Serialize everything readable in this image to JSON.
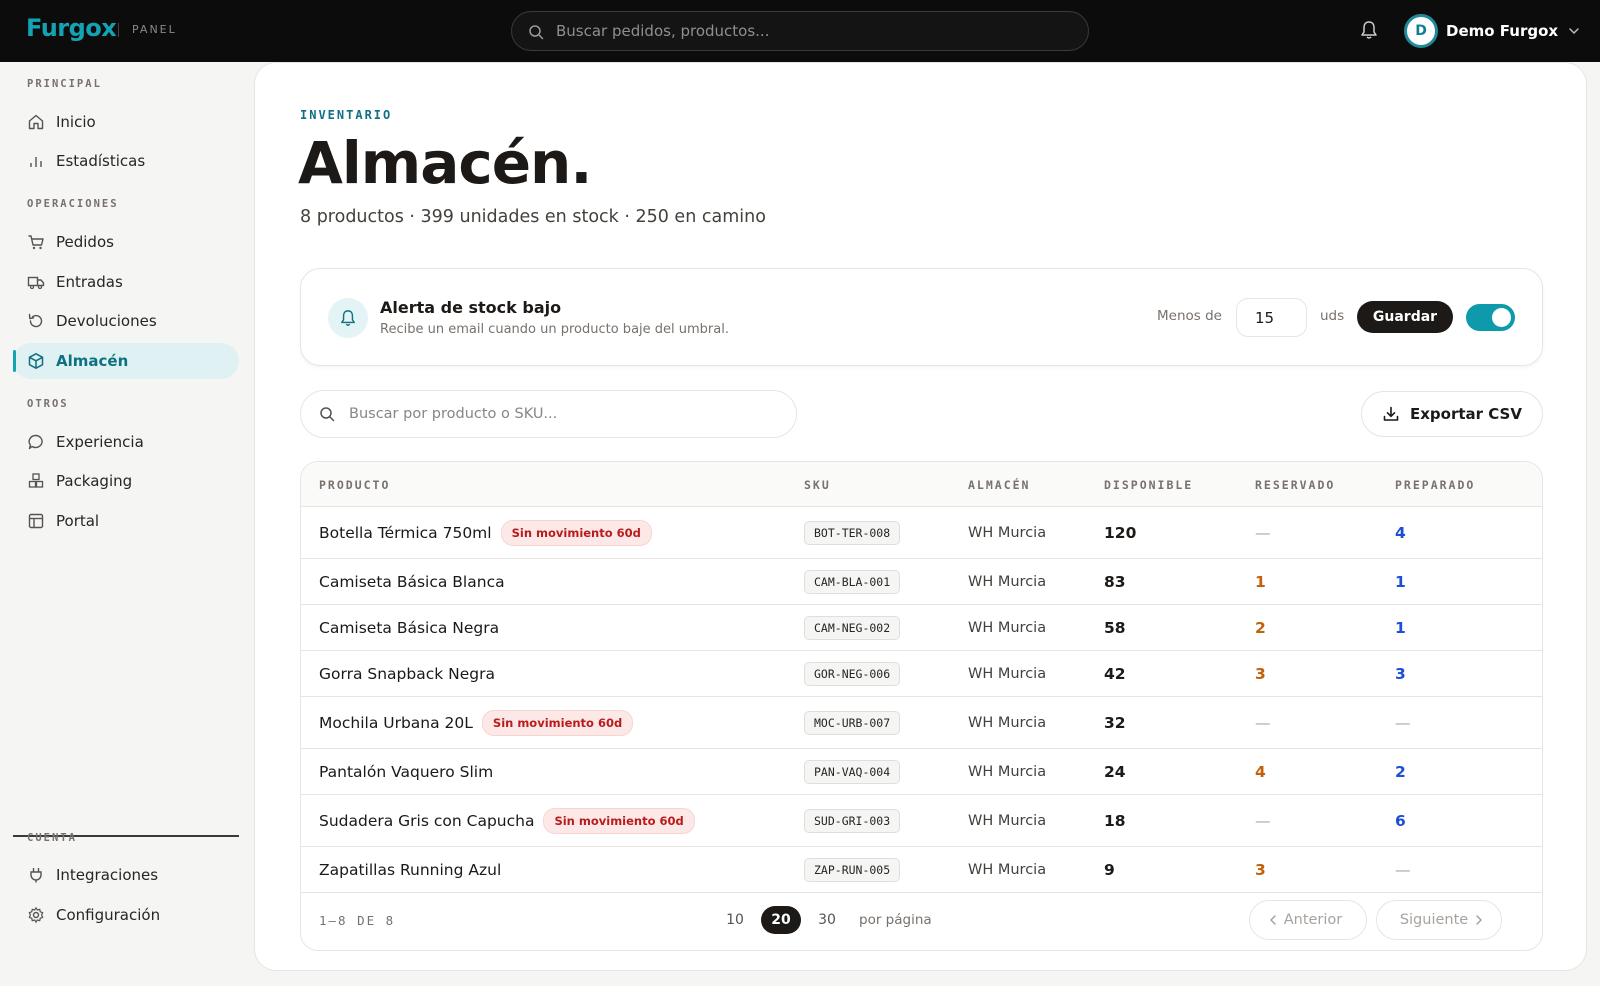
{
  "topbar": {
    "logo": "Furgox",
    "logo_sub": "PANEL",
    "search_placeholder": "Buscar pedidos, productos...",
    "user_initial": "D",
    "user_name": "Demo Furgox"
  },
  "sidebar": {
    "sections": {
      "principal": "PRINCIPAL",
      "operaciones": "OPERACIONES",
      "otros": "OTROS",
      "cuenta": "CUENTA"
    },
    "items": {
      "inicio": "Inicio",
      "estadisticas": "Estadísticas",
      "pedidos": "Pedidos",
      "entradas": "Entradas",
      "devoluciones": "Devoluciones",
      "almacen": "Almacén",
      "experiencia": "Experiencia",
      "packaging": "Packaging",
      "portal": "Portal",
      "integraciones": "Integraciones",
      "configuracion": "Configuración"
    },
    "active": "almacen"
  },
  "page": {
    "eyebrow": "INVENTARIO",
    "title": "Almacén.",
    "summary": "8 productos · 399 unidades en stock · 250 en camino"
  },
  "alert": {
    "title": "Alerta de stock bajo",
    "description": "Recibe un email cuando un producto baje del umbral.",
    "menos_label": "Menos de",
    "threshold": "15",
    "unit": "uds",
    "save_label": "Guardar",
    "enabled": true
  },
  "table_search": {
    "placeholder": "Buscar por producto o SKU..."
  },
  "export_label": "Exportar CSV",
  "table": {
    "headers": {
      "producto": "PRODUCTO",
      "sku": "SKU",
      "almacen": "ALMACÉN",
      "disponible": "DISPONIBLE",
      "reservado": "RESERVADO",
      "preparado": "PREPARADO"
    },
    "rows": [
      {
        "product": "Botella Térmica 750ml",
        "badge": "Sin movimiento 60d",
        "sku": "BOT-TER-008",
        "warehouse": "WH Murcia",
        "available": "120",
        "reserved": "—",
        "prepared": "4"
      },
      {
        "product": "Camiseta Básica Blanca",
        "badge": "",
        "sku": "CAM-BLA-001",
        "warehouse": "WH Murcia",
        "available": "83",
        "reserved": "1",
        "prepared": "1"
      },
      {
        "product": "Camiseta Básica Negra",
        "badge": "",
        "sku": "CAM-NEG-002",
        "warehouse": "WH Murcia",
        "available": "58",
        "reserved": "2",
        "prepared": "1"
      },
      {
        "product": "Gorra Snapback Negra",
        "badge": "",
        "sku": "GOR-NEG-006",
        "warehouse": "WH Murcia",
        "available": "42",
        "reserved": "3",
        "prepared": "3"
      },
      {
        "product": "Mochila Urbana 20L",
        "badge": "Sin movimiento 60d",
        "sku": "MOC-URB-007",
        "warehouse": "WH Murcia",
        "available": "32",
        "reserved": "—",
        "prepared": "—"
      },
      {
        "product": "Pantalón Vaquero Slim",
        "badge": "",
        "sku": "PAN-VAQ-004",
        "warehouse": "WH Murcia",
        "available": "24",
        "reserved": "4",
        "prepared": "2"
      },
      {
        "product": "Sudadera Gris con Capucha",
        "badge": "Sin movimiento 60d",
        "sku": "SUD-GRI-003",
        "warehouse": "WH Murcia",
        "available": "18",
        "reserved": "—",
        "prepared": "6"
      },
      {
        "product": "Zapatillas Running Azul",
        "badge": "",
        "sku": "ZAP-RUN-005",
        "warehouse": "WH Murcia",
        "available": "9",
        "reserved": "3",
        "prepared": "—"
      }
    ]
  },
  "pagination": {
    "range": "1–8 DE 8",
    "sizes": [
      "10",
      "20",
      "30"
    ],
    "active_size": "20",
    "per_page": "por página",
    "prev": "Anterior",
    "next": "Siguiente"
  },
  "colors": {
    "brand": "#14a3b4",
    "reserved": "#c2610c",
    "prepared": "#1d4ed8",
    "badge_red": "#b91c1c"
  }
}
